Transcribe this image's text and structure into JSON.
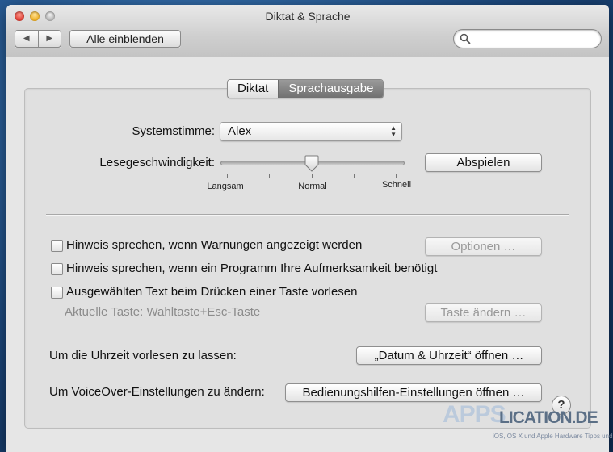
{
  "window": {
    "title": "Diktat & Sprache"
  },
  "toolbar": {
    "show_all_label": "Alle einblenden",
    "search_placeholder": ""
  },
  "tabs": [
    {
      "label": "Diktat",
      "selected": false
    },
    {
      "label": "Sprachausgabe",
      "selected": true
    }
  ],
  "speech": {
    "voice_label": "Systemstimme:",
    "voice_value": "Alex",
    "rate_label": "Lesegeschwindigkeit:",
    "rate_value_fraction": 0.5,
    "rate_tick_labels": [
      "Langsam",
      "Normal",
      "Schnell"
    ],
    "play_button": "Abspielen"
  },
  "options": {
    "warn_label": "Hinweis sprechen, wenn Warnungen angezeigt werden",
    "warn_checked": false,
    "options_button": "Optionen …",
    "attention_label": "Hinweis sprechen, wenn ein Programm Ihre Aufmerksamkeit benötigt",
    "attention_checked": false,
    "selected_text_label": "Ausgewählten Text beim Drücken einer Taste vorlesen",
    "selected_text_checked": false,
    "current_key_label": "Aktuelle Taste: Wahltaste+Esc-Taste",
    "change_key_button": "Taste ändern …"
  },
  "links": {
    "time_label": "Um die Uhrzeit vorlesen zu lassen:",
    "time_button": "„Datum & Uhrzeit“ öffnen …",
    "voiceover_label": "Um VoiceOver-Einstellungen zu ändern:",
    "voiceover_button": "Bedienungshilfen-Einstellungen öffnen …"
  },
  "help": {
    "label": "?"
  },
  "watermark": {
    "part1": "APPS",
    "part2": "LICATION.DE",
    "tagline": "iOS, OS X und Apple Hardware Tipps und Tests"
  }
}
